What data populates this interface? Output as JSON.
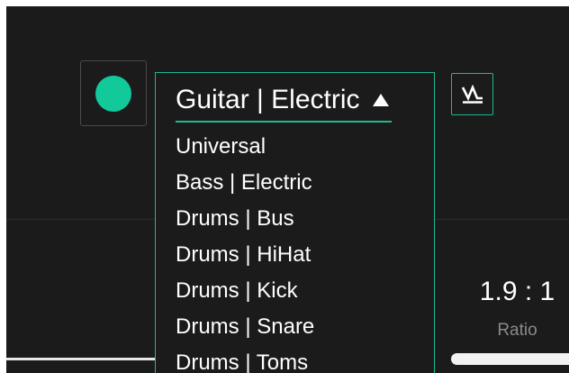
{
  "color_selector": {
    "color": "#12c999",
    "icon": "circle-swatch-icon"
  },
  "dropdown": {
    "selected": "Guitar | Electric",
    "accent": "#1fb891",
    "options": [
      "Universal",
      "Bass | Electric",
      "Drums | Bus",
      "Drums | HiHat",
      "Drums | Kick",
      "Drums | Snare",
      "Drums | Toms"
    ]
  },
  "waveform_button": {
    "icon": "waveform-icon"
  },
  "ratio": {
    "value": "1.9 : 1",
    "label": "Ratio"
  }
}
